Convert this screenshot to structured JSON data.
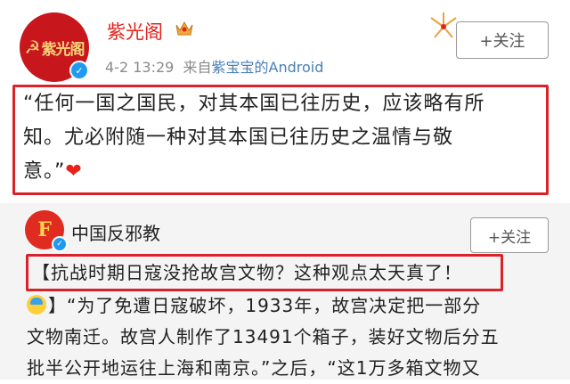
{
  "post1": {
    "author": "紫光阁",
    "avatar_text": "紫光阁",
    "timestamp": "4-2 13:29",
    "source_prefix": "来自",
    "source_app": "紫宝宝的Android",
    "follow_label": "+关注",
    "quote_line1": "“任何一国之国民，对其本国已往历史，应该略有所",
    "quote_line2": "知。尤必附随一种对其本国已往历史之温情与敬",
    "quote_line3": "意。”",
    "heart": "❤"
  },
  "post2": {
    "author": "中国反邪教",
    "follow_label": "+关注",
    "headline": "【抗战时期日寇没抢故宫文物？这种观点太天真了！",
    "body_line1": "】“为了免遭日寇破坏，1933年，故宫决定把一部分",
    "body_line2": "文物南迁。故宫人制作了13491个箱子，装好文物后分五",
    "body_line3": "批半公开地运往上海和南京。”之后，“这1万多箱文物又"
  },
  "colors": {
    "accent_red": "#d9232b",
    "name_red": "#e2231a",
    "verified_blue": "#1e9bf0",
    "link_blue": "#4a7fb5"
  }
}
